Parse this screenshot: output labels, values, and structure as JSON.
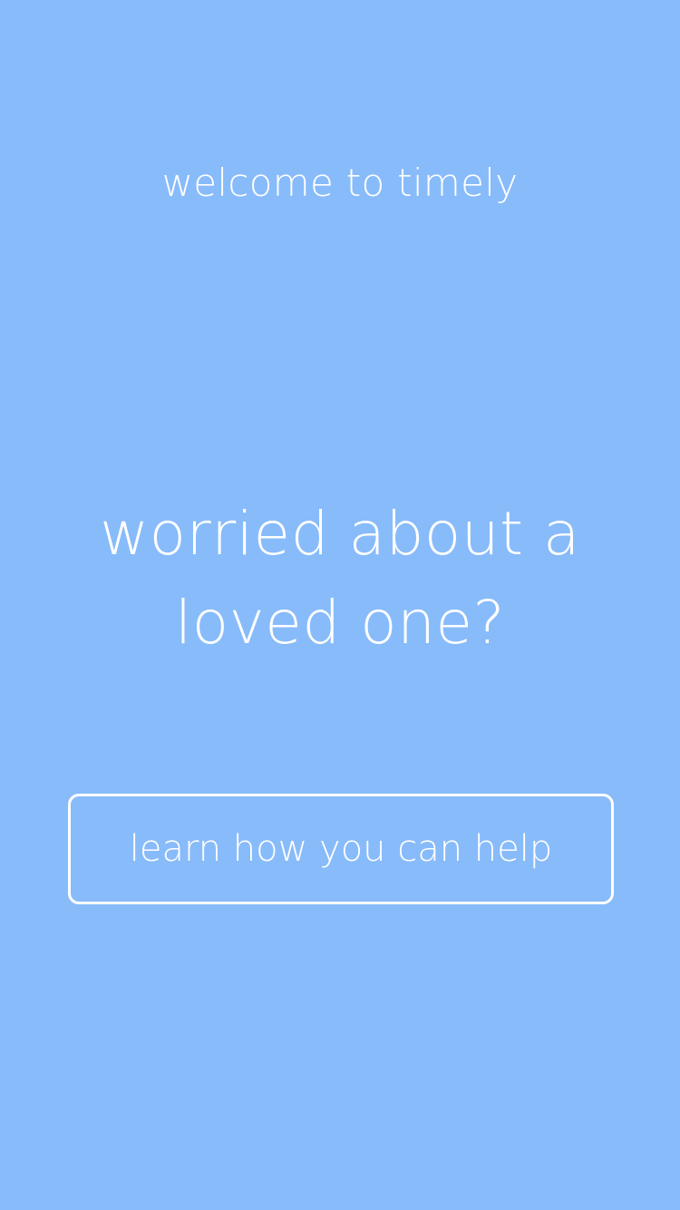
{
  "theme": {
    "background": "#88bbfa",
    "text": "#ffffff"
  },
  "welcome": {
    "text": "welcome to timely"
  },
  "hero": {
    "line1": "worried about a",
    "line2": "loved one?"
  },
  "cta": {
    "label": "learn how you can help"
  }
}
